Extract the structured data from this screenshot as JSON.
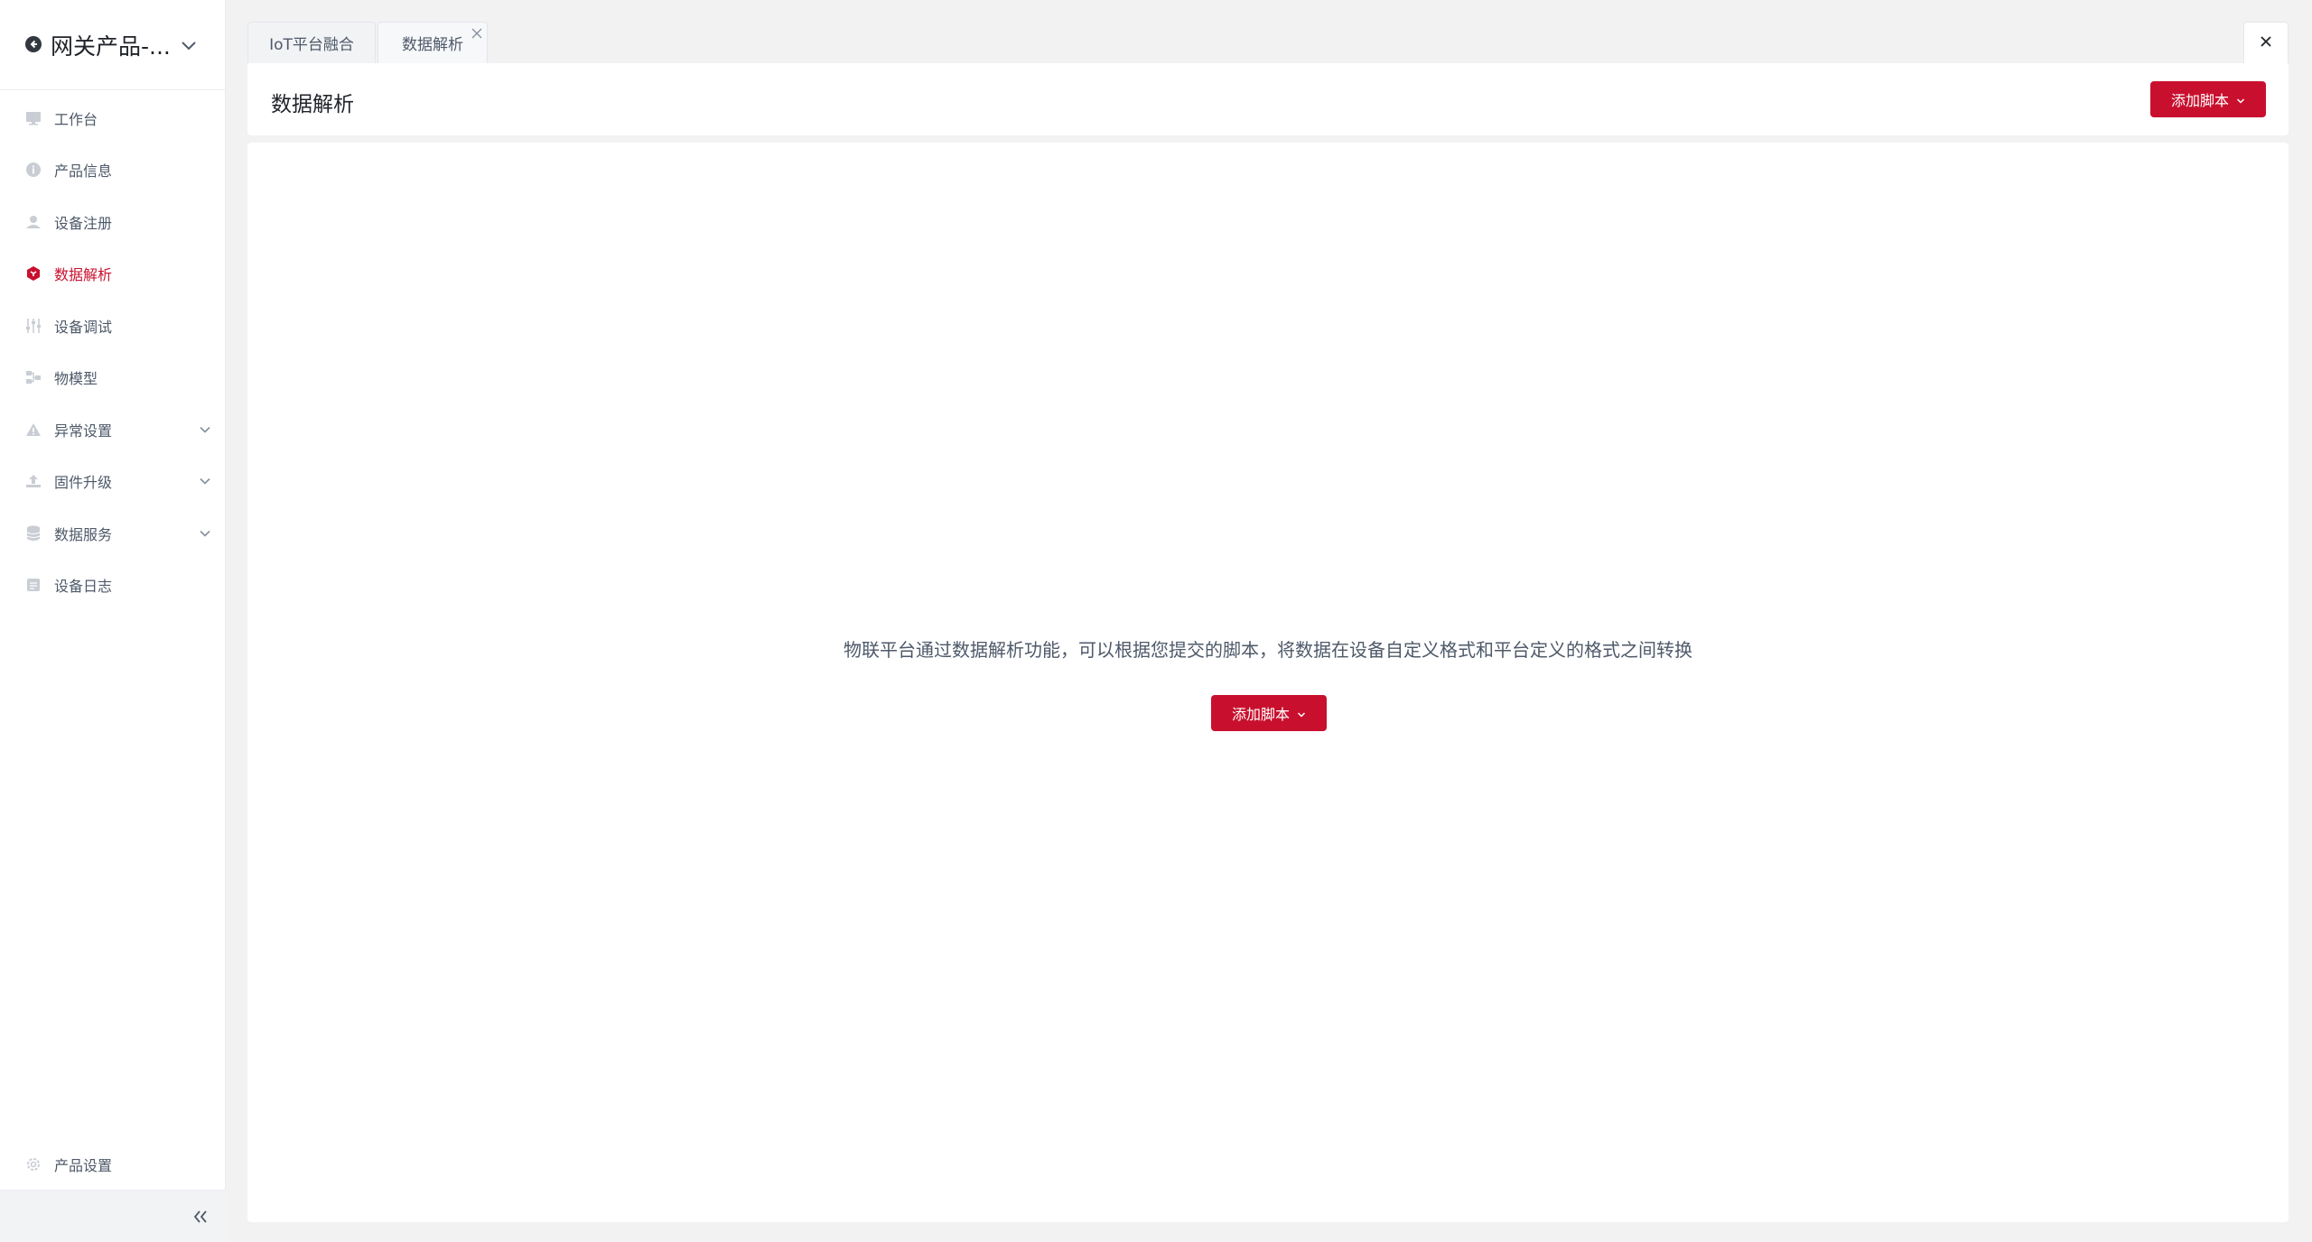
{
  "sidebar": {
    "title": "网关产品-...",
    "items": [
      {
        "label": "工作台",
        "icon": "monitor-icon",
        "active": false,
        "expandable": false
      },
      {
        "label": "产品信息",
        "icon": "info-icon",
        "active": false,
        "expandable": false
      },
      {
        "label": "设备注册",
        "icon": "device-register-icon",
        "active": false,
        "expandable": false
      },
      {
        "label": "数据解析",
        "icon": "data-parse-icon",
        "active": true,
        "expandable": false
      },
      {
        "label": "设备调试",
        "icon": "sliders-icon",
        "active": false,
        "expandable": false
      },
      {
        "label": "物模型",
        "icon": "model-icon",
        "active": false,
        "expandable": false
      },
      {
        "label": "异常设置",
        "icon": "warning-icon",
        "active": false,
        "expandable": true
      },
      {
        "label": "固件升级",
        "icon": "upload-icon",
        "active": false,
        "expandable": true
      },
      {
        "label": "数据服务",
        "icon": "database-icon",
        "active": false,
        "expandable": true
      },
      {
        "label": "设备日志",
        "icon": "log-icon",
        "active": false,
        "expandable": false
      }
    ],
    "settings_label": "产品设置"
  },
  "tabs": [
    {
      "label": "IoT平台融合",
      "active": false,
      "closable": false
    },
    {
      "label": "数据解析",
      "active": true,
      "closable": true
    }
  ],
  "page": {
    "title": "数据解析",
    "header_button": "添加脚本"
  },
  "empty_state": {
    "message": "物联平台通过数据解析功能，可以根据您提交的脚本，将数据在设备自定义格式和平台定义的格式之间转换",
    "button": "添加脚本"
  },
  "colors": {
    "accent": "#c8102e",
    "text_primary": "#1f2329",
    "text_secondary": "#4e5969",
    "icon_gray": "#a9aeb8",
    "background": "#f2f2f3"
  }
}
